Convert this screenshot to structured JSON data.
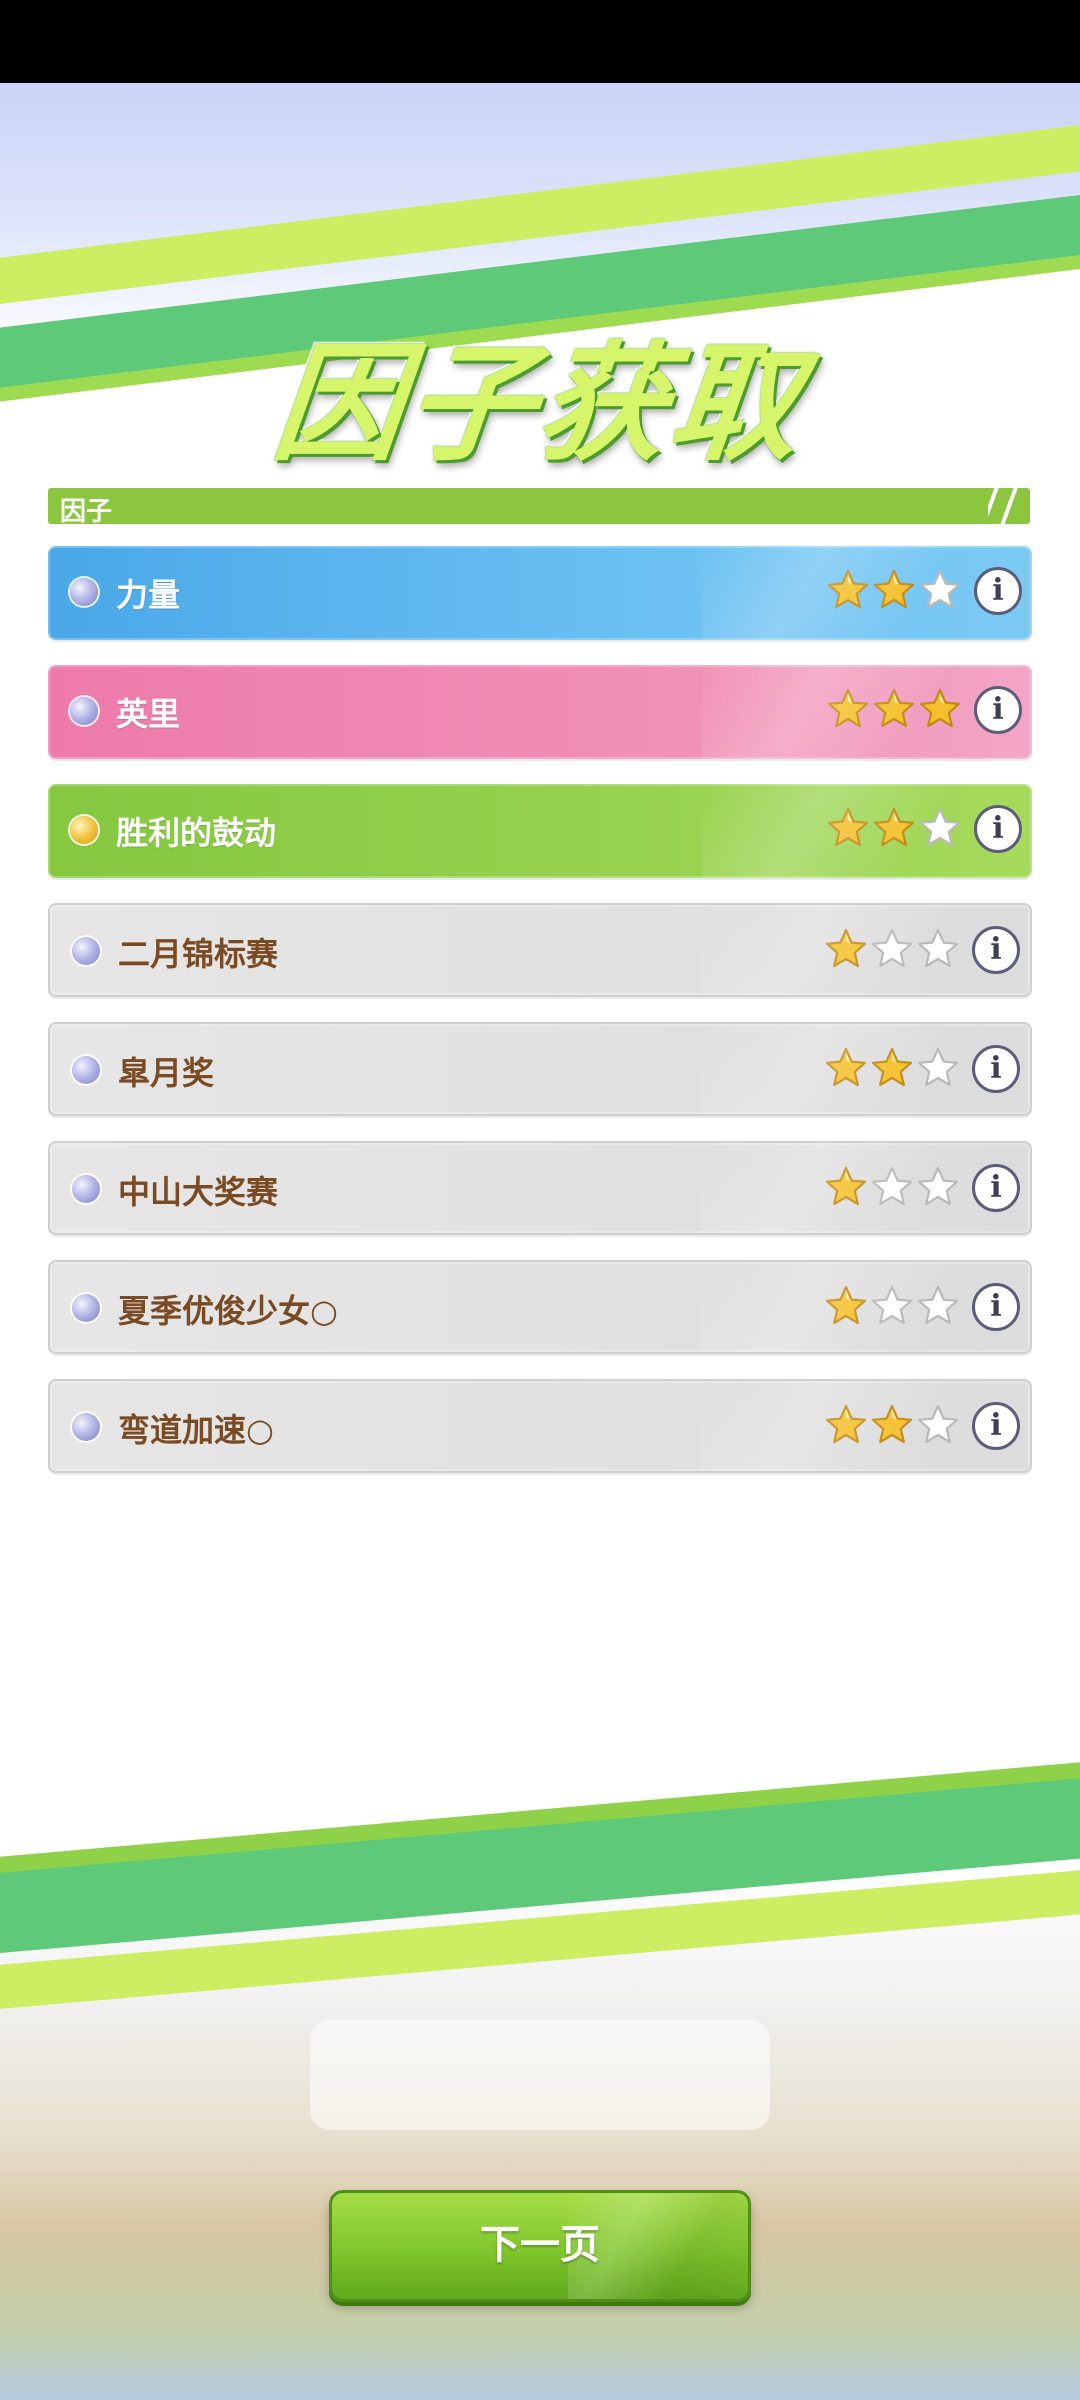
{
  "title": "因子获取",
  "section_label": "因子",
  "factors": [
    {
      "name": "力量",
      "rating": 2,
      "max_rating": 3,
      "color": "blue"
    },
    {
      "name": "英里",
      "rating": 3,
      "max_rating": 3,
      "color": "pink"
    },
    {
      "name": "胜利的鼓动",
      "rating": 2,
      "max_rating": 3,
      "color": "green"
    },
    {
      "name": "二月锦标赛",
      "rating": 1,
      "max_rating": 3,
      "color": "gray"
    },
    {
      "name": "皐月奖",
      "rating": 2,
      "max_rating": 3,
      "color": "gray"
    },
    {
      "name": "中山大奖赛",
      "rating": 1,
      "max_rating": 3,
      "color": "gray"
    },
    {
      "name": "夏季优俊少女○",
      "rating": 1,
      "max_rating": 3,
      "color": "gray"
    },
    {
      "name": "弯道加速○",
      "rating": 2,
      "max_rating": 3,
      "color": "gray"
    }
  ],
  "info_symbol": "i",
  "next_button_label": "下一页",
  "colors": {
    "accent_green": "#8cc63f",
    "blue_row": "#4aa8e8",
    "pink_row": "#ee7aaa",
    "green_row": "#85c840",
    "gray_row": "#e3e3e3",
    "gray_text": "#7a4a23",
    "star_gold": "#f5c02c"
  },
  "icons": {
    "info": "info-icon",
    "star_filled": "star-filled-icon",
    "star_empty": "star-empty-icon"
  }
}
